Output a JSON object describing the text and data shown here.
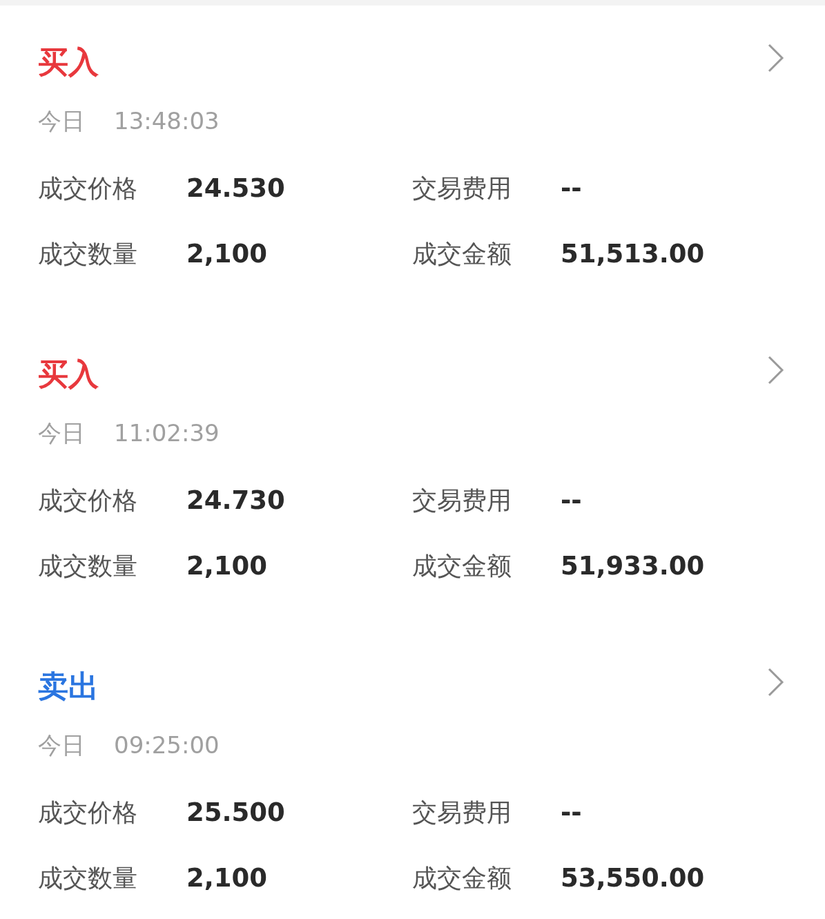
{
  "trades": [
    {
      "kind": "buy",
      "side": "买入",
      "day": "今日",
      "time": "13:48:03",
      "fields": [
        {
          "label": "成交价格",
          "value": "24.530"
        },
        {
          "label": "交易费用",
          "value": "--"
        },
        {
          "label": "成交数量",
          "value": "2,100"
        },
        {
          "label": "成交金额",
          "value": "51,513.00"
        }
      ]
    },
    {
      "kind": "buy",
      "side": "买入",
      "day": "今日",
      "time": "11:02:39",
      "fields": [
        {
          "label": "成交价格",
          "value": "24.730"
        },
        {
          "label": "交易费用",
          "value": "--"
        },
        {
          "label": "成交数量",
          "value": "2,100"
        },
        {
          "label": "成交金额",
          "value": "51,933.00"
        }
      ]
    },
    {
      "kind": "sell",
      "side": "卖出",
      "day": "今日",
      "time": "09:25:00",
      "fields": [
        {
          "label": "成交价格",
          "value": "25.500"
        },
        {
          "label": "交易费用",
          "value": "--"
        },
        {
          "label": "成交数量",
          "value": "2,100"
        },
        {
          "label": "成交金额",
          "value": "53,550.00"
        }
      ]
    }
  ]
}
